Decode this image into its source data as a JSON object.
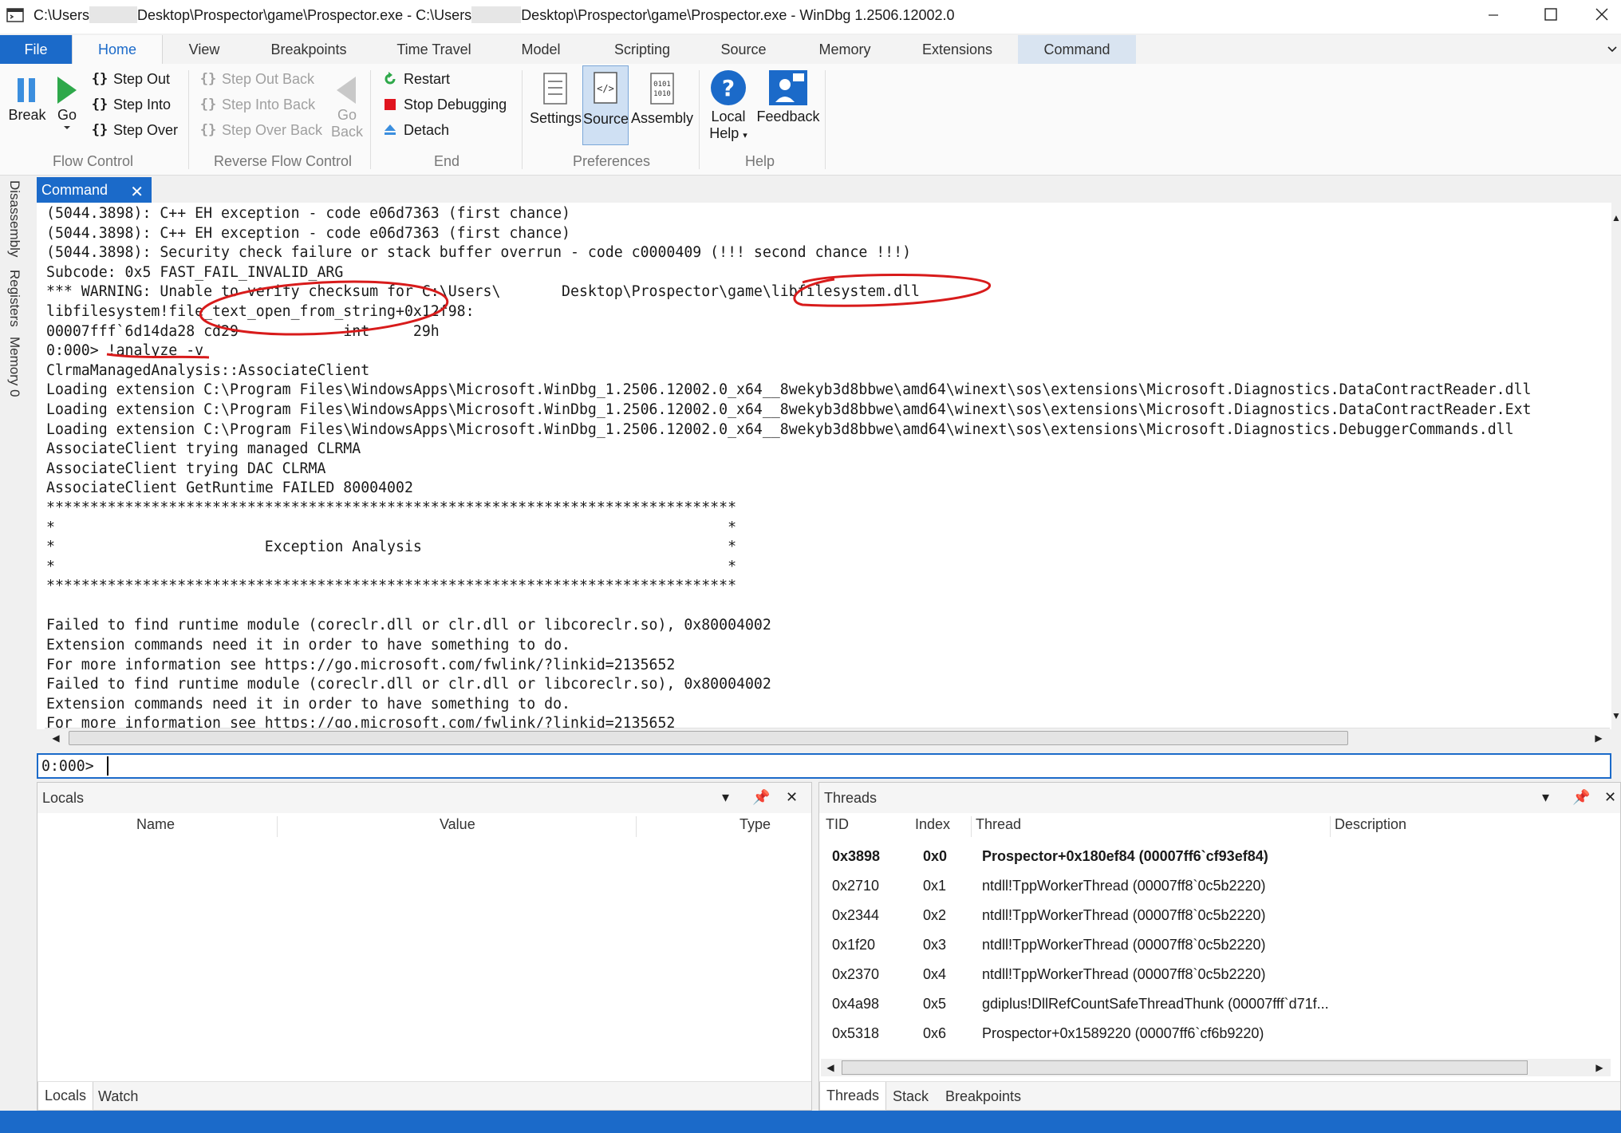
{
  "window": {
    "title_prefix": "C:\\Users",
    "title_mid": "Desktop\\Prospector\\game\\Prospector.exe - C:\\Users",
    "title_suffix": "Desktop\\Prospector\\game\\Prospector.exe  - WinDbg 1.2506.12002.0"
  },
  "ribbon_tabs": {
    "file": "File",
    "home": "Home",
    "view": "View",
    "breakpoints": "Breakpoints",
    "time_travel": "Time Travel",
    "model": "Model",
    "scripting": "Scripting",
    "source": "Source",
    "memory": "Memory",
    "extensions": "Extensions",
    "command": "Command"
  },
  "ribbon": {
    "flow_control": {
      "label": "Flow Control",
      "break": "Break",
      "go": "Go",
      "step_out": "Step Out",
      "step_into": "Step Into",
      "step_over": "Step Over"
    },
    "reverse_flow_control": {
      "label": "Reverse Flow Control",
      "step_out_back": "Step Out Back",
      "step_into_back": "Step Into Back",
      "step_over_back": "Step Over Back",
      "go_back_1": "Go",
      "go_back_2": "Back"
    },
    "end": {
      "label": "End",
      "restart": "Restart",
      "stop_debugging": "Stop Debugging",
      "detach": "Detach"
    },
    "preferences": {
      "label": "Preferences",
      "settings": "Settings",
      "source": "Source",
      "assembly": "Assembly"
    },
    "help": {
      "label": "Help",
      "local_help_1": "Local",
      "local_help_2": "Help",
      "feedback": "Feedback"
    }
  },
  "sidebar": {
    "disassembly": "Disassembly",
    "registers": "Registers",
    "memory0": "Memory 0"
  },
  "command_window": {
    "tab_label": "Command",
    "lines": [
      "(5044.3898): C++ EH exception - code e06d7363 (first chance)",
      "(5044.3898): C++ EH exception - code e06d7363 (first chance)",
      "(5044.3898): Security check failure or stack buffer overrun - code c0000409 (!!! second chance !!!)",
      "Subcode: 0x5 FAST_FAIL_INVALID_ARG",
      "*** WARNING: Unable to verify checksum for C:\\Users\\       Desktop\\Prospector\\game\\libfilesystem.dll",
      "libfilesystem!file_text_open_from_string+0x12f98:",
      "00007fff`6d14da28 cd29            int     29h",
      "0:000> !analyze -v",
      "ClrmaManagedAnalysis::AssociateClient",
      "Loading extension C:\\Program Files\\WindowsApps\\Microsoft.WinDbg_1.2506.12002.0_x64__8wekyb3d8bbwe\\amd64\\winext\\sos\\extensions\\Microsoft.Diagnostics.DataContractReader.dll",
      "Loading extension C:\\Program Files\\WindowsApps\\Microsoft.WinDbg_1.2506.12002.0_x64__8wekyb3d8bbwe\\amd64\\winext\\sos\\extensions\\Microsoft.Diagnostics.DataContractReader.Ext",
      "Loading extension C:\\Program Files\\WindowsApps\\Microsoft.WinDbg_1.2506.12002.0_x64__8wekyb3d8bbwe\\amd64\\winext\\sos\\extensions\\Microsoft.Diagnostics.DebuggerCommands.dll",
      "AssociateClient trying managed CLRMA",
      "AssociateClient trying DAC CLRMA",
      "AssociateClient GetRuntime FAILED 80004002",
      "*******************************************************************************",
      "*                                                                             *",
      "*                        Exception Analysis                                   *",
      "*                                                                             *",
      "*******************************************************************************",
      "",
      "Failed to find runtime module (coreclr.dll or clr.dll or libcoreclr.so), 0x80004002",
      "Extension commands need it in order to have something to do.",
      "For more information see https://go.microsoft.com/fwlink/?linkid=2135652",
      "Failed to find runtime module (coreclr.dll or clr.dll or libcoreclr.so), 0x80004002",
      "Extension commands need it in order to have something to do.",
      "For more information see https://go.microsoft.com/fwlink/?linkid=2135652"
    ],
    "prompt": "0:000>",
    "input_value": ""
  },
  "locals_panel": {
    "title": "Locals",
    "columns": [
      "Name",
      "Value",
      "Type"
    ],
    "tabs": [
      "Locals",
      "Watch"
    ]
  },
  "threads_panel": {
    "title": "Threads",
    "columns": [
      "TID",
      "Index",
      "Thread",
      "Description"
    ],
    "rows": [
      {
        "tid": "0x3898",
        "index": "0x0",
        "thread": "Prospector+0x180ef84 (00007ff6`cf93ef84)",
        "description": ""
      },
      {
        "tid": "0x2710",
        "index": "0x1",
        "thread": "ntdll!TppWorkerThread (00007ff8`0c5b2220)",
        "description": ""
      },
      {
        "tid": "0x2344",
        "index": "0x2",
        "thread": "ntdll!TppWorkerThread (00007ff8`0c5b2220)",
        "description": ""
      },
      {
        "tid": "0x1f20",
        "index": "0x3",
        "thread": "ntdll!TppWorkerThread (00007ff8`0c5b2220)",
        "description": ""
      },
      {
        "tid": "0x2370",
        "index": "0x4",
        "thread": "ntdll!TppWorkerThread (00007ff8`0c5b2220)",
        "description": ""
      },
      {
        "tid": "0x4a98",
        "index": "0x5",
        "thread": "gdiplus!DllRefCountSafeThreadThunk (00007fff`d71f...",
        "description": ""
      },
      {
        "tid": "0x5318",
        "index": "0x6",
        "thread": "Prospector+0x1589220 (00007ff6`cf6b9220)",
        "description": ""
      }
    ],
    "tabs": [
      "Threads",
      "Stack",
      "Breakpoints"
    ]
  },
  "colors": {
    "accent": "#1b6ac9",
    "annotation": "#d81b1b"
  }
}
